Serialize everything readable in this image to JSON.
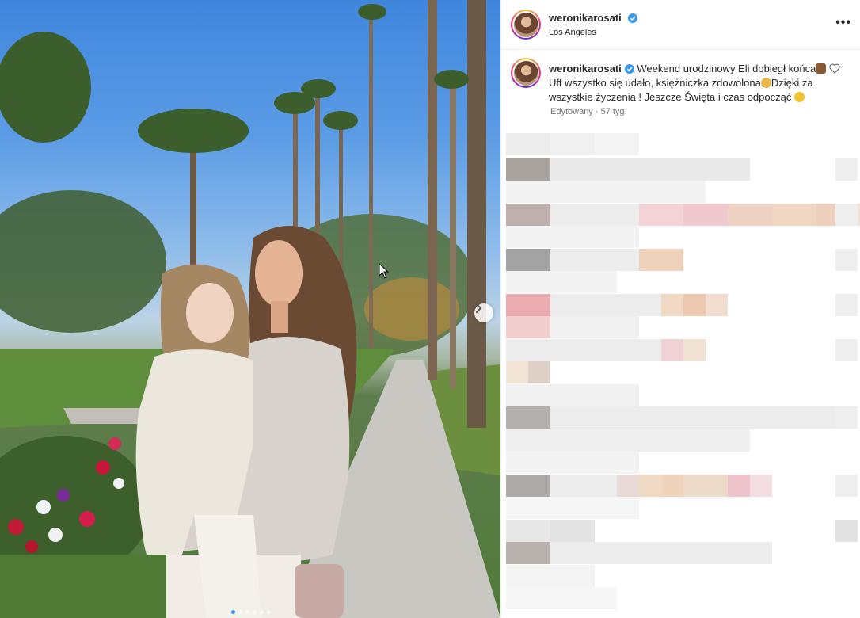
{
  "post": {
    "username": "weronikarosati",
    "location": "Los Angeles",
    "more_label": "•••",
    "caption_line1": "Weekend urodzinowy Eli dobiegł końca",
    "caption_line2": "Uff wszystko się udało, księżniczka zdowolona",
    "caption_line2b": "Dzięki za",
    "caption_line3": "wszystkie życzenia ! Jeszcze Święta i czas odpocząć",
    "meta": "Edytowany · 57 tyg."
  },
  "carousel": {
    "next_icon": "chevron-right-icon",
    "slides": 6,
    "active_index": 0
  },
  "colors": {
    "verified": "#3897f0",
    "accent": "#0095f6",
    "text": "#262626",
    "muted": "#737373"
  }
}
